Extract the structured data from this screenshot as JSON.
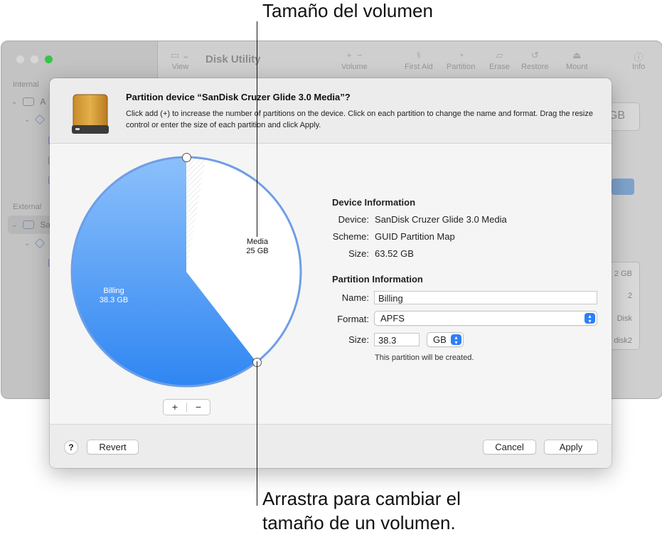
{
  "background_window": {
    "title": "Disk Utility",
    "sidebar": {
      "sections": [
        "Internal",
        "External"
      ],
      "rows": [
        {
          "label": "A",
          "level": 0,
          "section": "Internal"
        },
        {
          "label": "",
          "level": 1,
          "section": "Internal"
        },
        {
          "label": "Sa",
          "level": 0,
          "section": "External"
        },
        {
          "label": "",
          "level": 1,
          "section": "External"
        }
      ]
    },
    "toolbar": {
      "view": "View",
      "volume": "Volume",
      "first_aid": "First Aid",
      "partition": "Partition",
      "erase": "Erase",
      "restore": "Restore",
      "mount": "Mount",
      "info": "Info"
    },
    "pane_cells": [
      "2 GB",
      "2",
      "Disk",
      "disk2"
    ],
    "size_box": "GB"
  },
  "sheet": {
    "title": "Partition device “SanDisk Cruzer Glide 3.0 Media”?",
    "description": "Click add (+) to increase the number of partitions on the device. Click on each partition to change the name and format. Drag the resize control or enter the size of each partition and click Apply.",
    "pie": {
      "partitions": [
        {
          "name": "Billing",
          "size": "38.3 GB",
          "value_gb": 38.3,
          "color": "#4a93f2"
        },
        {
          "name": "Media",
          "size": "25 GB",
          "value_gb": 25,
          "color": "#ffffff"
        }
      ],
      "total_gb": 63.52
    },
    "add_label": "+",
    "remove_label": "−",
    "device_info": {
      "heading": "Device Information",
      "device_label": "Device:",
      "device_value": "SanDisk Cruzer Glide 3.0 Media",
      "scheme_label": "Scheme:",
      "scheme_value": "GUID Partition Map",
      "size_label": "Size:",
      "size_value": "63.52 GB"
    },
    "partition_info": {
      "heading": "Partition Information",
      "name_label": "Name:",
      "name_value": "Billing",
      "format_label": "Format:",
      "format_value": "APFS",
      "size_label": "Size:",
      "size_value": "38.3",
      "unit_value": "GB",
      "note": "This partition will be created."
    },
    "footer": {
      "help": "?",
      "revert": "Revert",
      "cancel": "Cancel",
      "apply": "Apply"
    }
  },
  "callouts": {
    "top": "Tamaño del volumen",
    "bottom_line1": "Arrastra para cambiar el",
    "bottom_line2": "tamaño de un volumen."
  }
}
